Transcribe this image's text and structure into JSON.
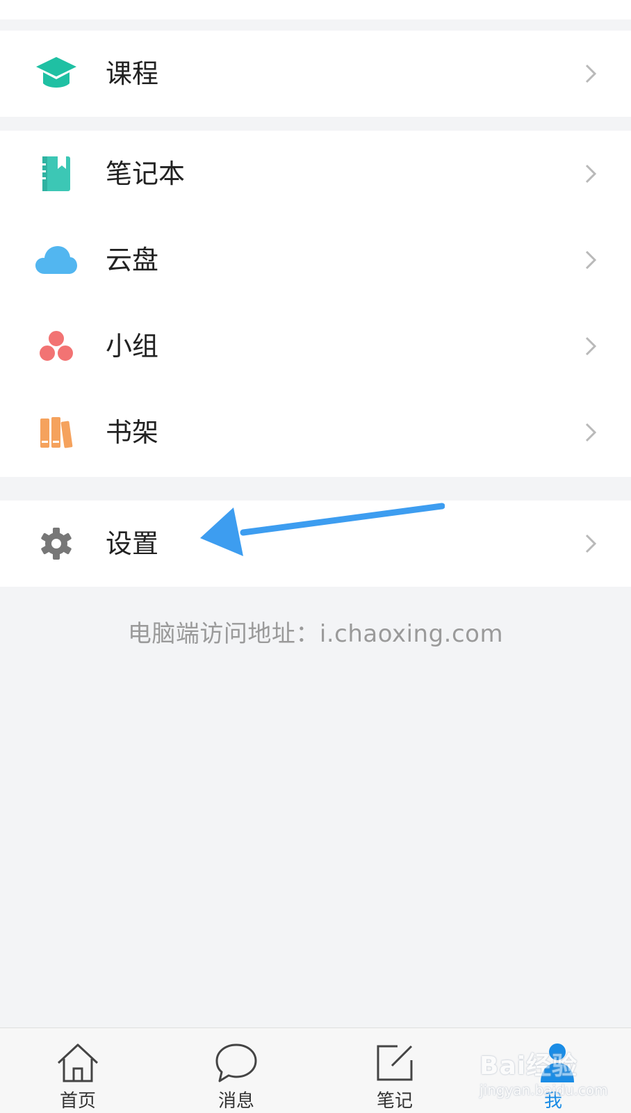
{
  "menu": {
    "group1": [
      {
        "key": "course",
        "label": "课程",
        "icon": "graduation-cap-icon"
      }
    ],
    "group2": [
      {
        "key": "notebook",
        "label": "笔记本",
        "icon": "notebook-icon"
      },
      {
        "key": "cloud",
        "label": "云盘",
        "icon": "cloud-icon"
      },
      {
        "key": "group",
        "label": "小组",
        "icon": "group-icon"
      },
      {
        "key": "bookshelf",
        "label": "书架",
        "icon": "bookshelf-icon"
      }
    ],
    "group3": [
      {
        "key": "settings",
        "label": "设置",
        "icon": "gear-icon"
      }
    ]
  },
  "footer": {
    "pc_access": "电脑端访问地址：i.chaoxing.com"
  },
  "tabbar": {
    "items": [
      {
        "key": "home",
        "label": "首页",
        "icon": "home-icon"
      },
      {
        "key": "messages",
        "label": "消息",
        "icon": "chat-bubble-icon"
      },
      {
        "key": "notes",
        "label": "笔记",
        "icon": "edit-note-icon"
      },
      {
        "key": "me",
        "label": "我",
        "icon": "user-icon",
        "active": true
      }
    ]
  },
  "watermark": {
    "line1": "Bai",
    "line2": "经验",
    "line3": "jingyan.baidu.com"
  },
  "colors": {
    "course_icon": "#1fc0a3",
    "notebook_icon": "#3cc7b5",
    "cloud_icon": "#52b6f0",
    "group_icon": "#f27373",
    "bookshelf_icon": "#f5a25d",
    "gear_icon": "#777777",
    "arrow": "#3d9df0",
    "active_tab": "#1a8ce5"
  }
}
